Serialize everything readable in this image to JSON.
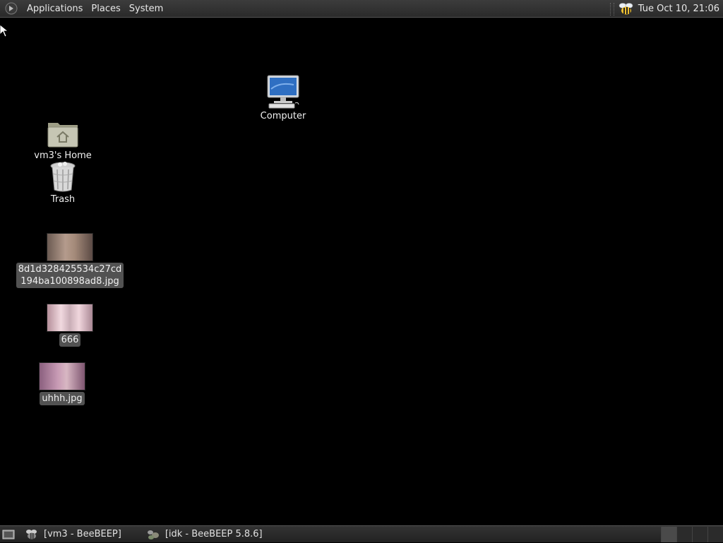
{
  "top_panel": {
    "menus": [
      "Applications",
      "Places",
      "System"
    ],
    "clock": "Tue Oct 10, 21:06"
  },
  "desktop": {
    "computer_label": "Computer",
    "home_label": "vm3's Home",
    "trash_label": "Trash",
    "file1_line1": "8d1d328425534c27cd",
    "file1_line2": "194ba100898ad8.jpg",
    "file2_label": "666",
    "file3_label": "uhhh.jpg"
  },
  "taskbar": {
    "tasks": [
      "[vm3 - BeeBEEP]",
      "[idk - BeeBEEP 5.8.6]"
    ]
  },
  "icons": {
    "menu_logo": "gnome-foot-icon",
    "tray": "beebeep-bee-icon",
    "show_desktop": "show-desktop-icon"
  },
  "colors": {
    "desktop_bg": "#000000",
    "panel_bg": "#2f2f2f"
  }
}
